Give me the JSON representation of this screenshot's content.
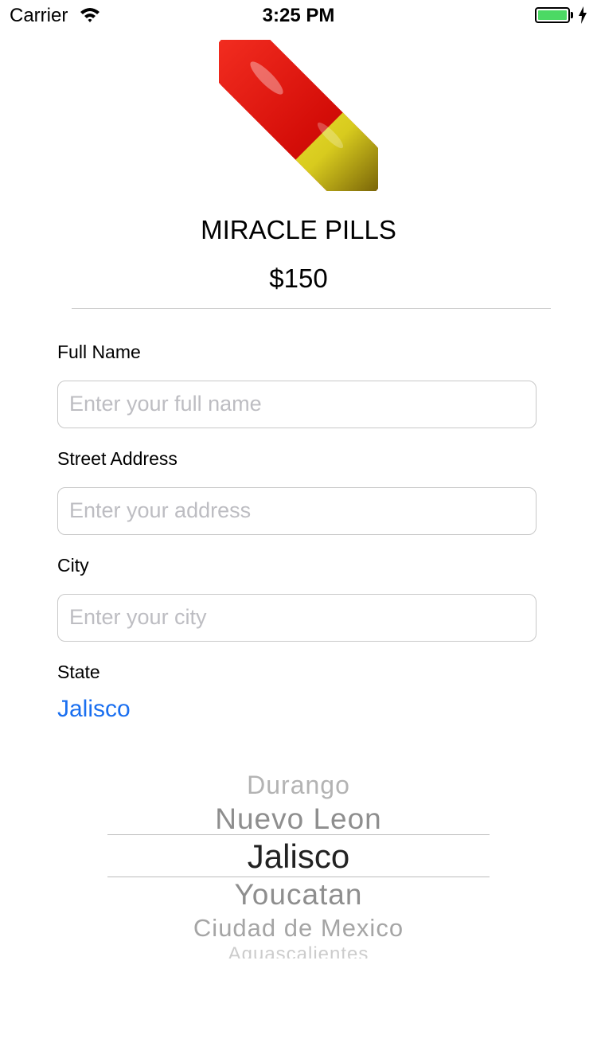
{
  "status_bar": {
    "carrier": "Carrier",
    "time": "3:25 PM",
    "wifi_icon": "wifi-icon",
    "battery_icon": "battery-charging-icon",
    "battery_color": "#4cd964"
  },
  "product": {
    "image_icon": "pill-icon",
    "name": "MIRACLE PILLS",
    "price": "$150"
  },
  "form": {
    "full_name": {
      "label": "Full Name",
      "value": "",
      "placeholder": "Enter your full name"
    },
    "street_address": {
      "label": "Street Address",
      "value": "",
      "placeholder": "Enter your address"
    },
    "city": {
      "label": "City",
      "value": "",
      "placeholder": "Enter your city"
    },
    "state": {
      "label": "State",
      "value": "Jalisco"
    }
  },
  "picker": {
    "options": [
      "Durango",
      "Nuevo Leon",
      "Jalisco",
      "Youcatan",
      "Ciudad de Mexico",
      "Aguascalientes"
    ],
    "selected": "Jalisco"
  },
  "colors": {
    "accent": "#1a6ff0",
    "placeholder": "#bdbdc2",
    "divider": "#cfcfcf"
  }
}
